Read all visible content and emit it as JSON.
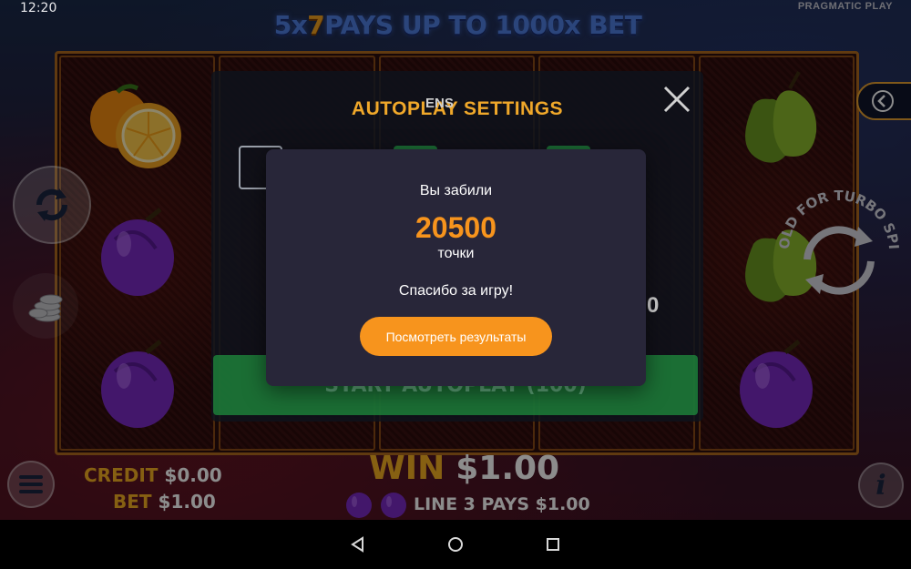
{
  "status_bar": {
    "time": "12:20"
  },
  "game": {
    "brand": "PRAGMATIC PLAY",
    "banner": {
      "prefix": "5x",
      "seven": "7",
      "suffix": " PAYS UP TO 1000x BET"
    },
    "credit_label": "CREDIT",
    "credit_value": "$0.00",
    "bet_label": "BET",
    "bet_value": "$1.00",
    "win_label": "WIN",
    "win_value": "$1.00",
    "pays_text": "LINE 3 PAYS $1.00",
    "turbo_label": "HOLD FOR TURBO SPIN"
  },
  "autoplay": {
    "title": "AUTOPLAY SETTINGS",
    "spins_label": "ENS",
    "value_partial": "0",
    "start_button": "START AUTOPLAY (100)"
  },
  "modal": {
    "scored_label": "Вы забили",
    "points": "20500",
    "points_unit": "точки",
    "thanks": "Спасибо за игру!",
    "results_button": "Посмотреть результаты"
  },
  "colors": {
    "accent": "#f7941d",
    "modal_bg": "#282639",
    "gold": "#f4b022"
  }
}
